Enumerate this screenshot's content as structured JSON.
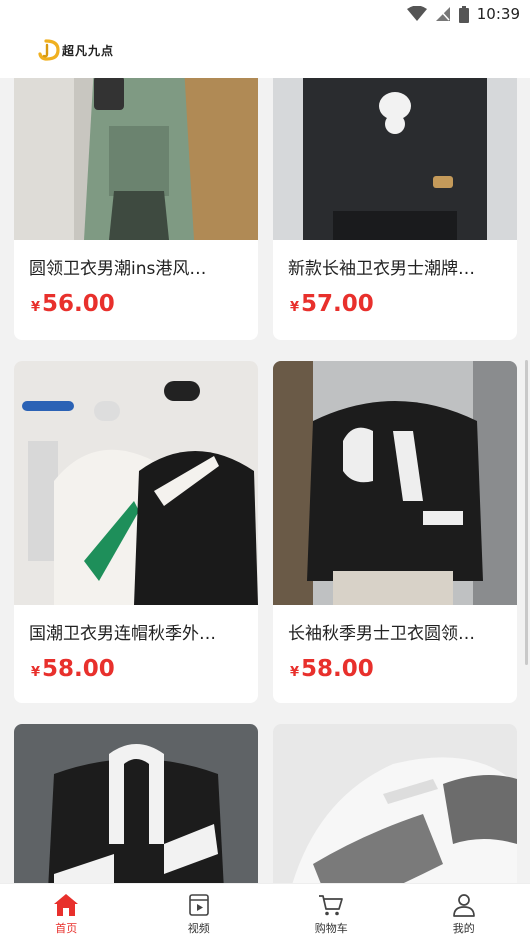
{
  "status_bar": {
    "time": "10:39"
  },
  "app": {
    "logo_text": "超凡九点",
    "accent_color": "#e8302c"
  },
  "products": [
    {
      "title": "圆领卫衣男潮ins港风…",
      "currency": "¥",
      "price": "56.00",
      "image": "green-sweatshirt-photo"
    },
    {
      "title": "新款长袖卫衣男士潮牌…",
      "currency": "¥",
      "price": "57.00",
      "image": "black-bear-sweatshirt-photo"
    },
    {
      "title": "国潮卫衣男连帽秋季外…",
      "currency": "¥",
      "price": "58.00",
      "image": "seven-hoodie-photo"
    },
    {
      "title": "长袖秋季男士卫衣圆领…",
      "currency": "¥",
      "price": "58.00",
      "image": "black-letter-sweatshirt-photo"
    },
    {
      "title": "",
      "currency": "",
      "price": "",
      "image": "black-white-hoodie-photo"
    },
    {
      "title": "",
      "currency": "",
      "price": "",
      "image": "sneaker-photo"
    }
  ],
  "tabbar": [
    {
      "label": "首页",
      "icon": "home-icon",
      "active": true
    },
    {
      "label": "视频",
      "icon": "video-icon",
      "active": false
    },
    {
      "label": "购物车",
      "icon": "cart-icon",
      "active": false
    },
    {
      "label": "我的",
      "icon": "user-icon",
      "active": false
    }
  ]
}
